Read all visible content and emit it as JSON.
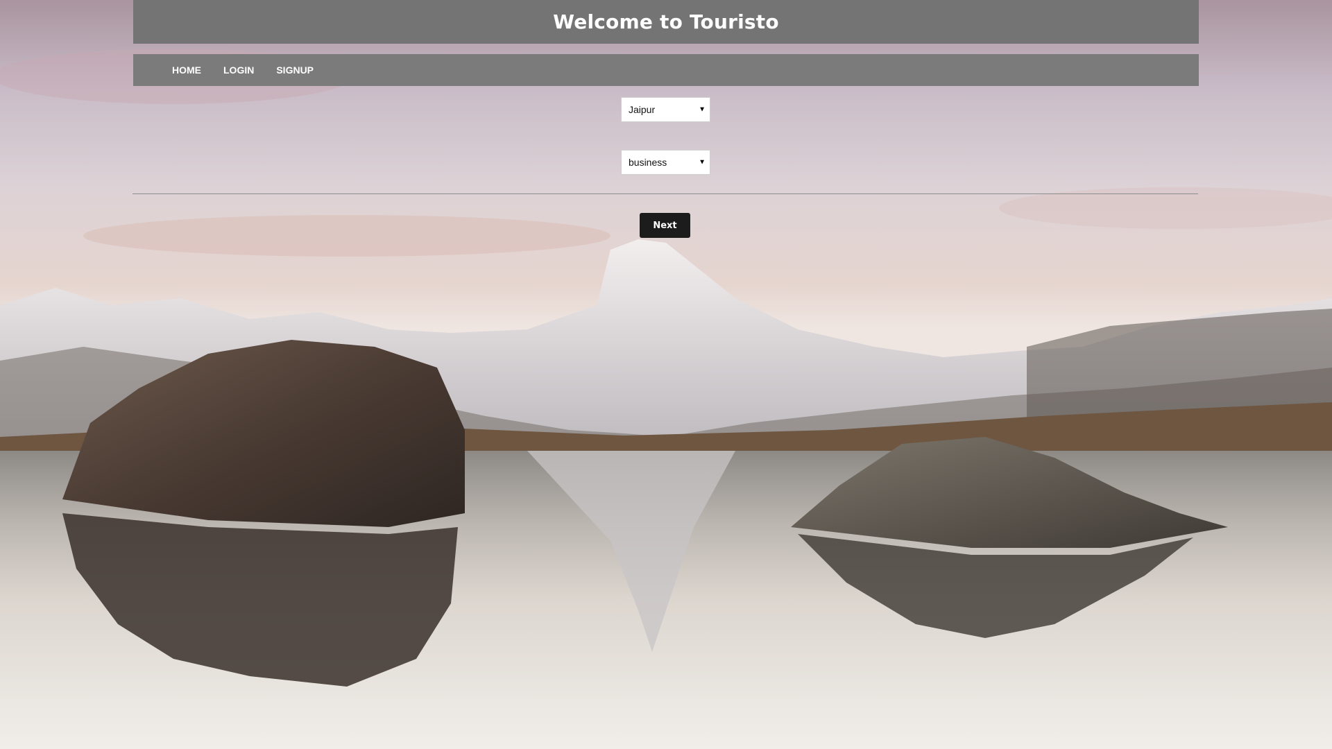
{
  "header": {
    "title": "Welcome to Touristo"
  },
  "nav": {
    "items": [
      {
        "label": "HOME"
      },
      {
        "label": "LOGIN"
      },
      {
        "label": "SIGNUP"
      }
    ]
  },
  "form": {
    "city_select": {
      "selected": "Jaipur"
    },
    "category_select": {
      "selected": "business"
    },
    "next_label": "Next"
  },
  "colors": {
    "header_bg": "#747474",
    "nav_bg": "#7b7b7b",
    "button_bg": "#1c1c1c",
    "text_light": "#ffffff"
  },
  "background": {
    "icon": "mountain-lake-landscape"
  }
}
